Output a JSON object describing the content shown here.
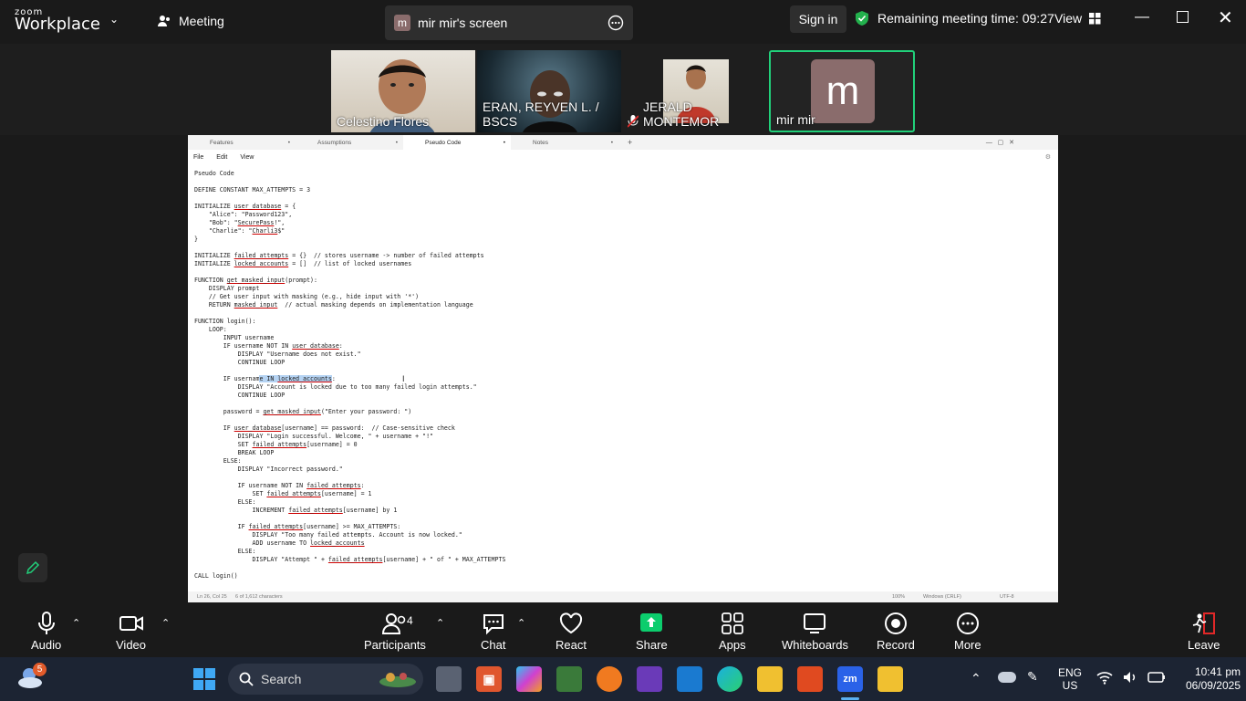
{
  "topbar": {
    "logo_line1": "zoom",
    "logo_line2": "Workplace",
    "meeting_label": "Meeting",
    "share_avatar": "m",
    "share_title": "mir mir's screen",
    "sign_in": "Sign in",
    "remaining_time": "Remaining meeting time: 09:27",
    "view_label": "View"
  },
  "participants": [
    {
      "name": "Celestino Flores"
    },
    {
      "name": "ERAN, REYVEN L. / BSCS"
    },
    {
      "name": "JERALD MONTEMOR"
    },
    {
      "name": "mir mir",
      "avatar": "m"
    }
  ],
  "editor": {
    "tabs": [
      "Features",
      "Assumptions",
      "Pseudo Code",
      "Notes"
    ],
    "active_tab": "Pseudo Code",
    "menu": [
      "File",
      "Edit",
      "View"
    ],
    "status_position": "Ln 26, Col 25",
    "status_chars": "6 of 1,612 characters",
    "status_zoom": "100%",
    "status_eol": "Windows (CRLF)",
    "status_encoding": "UTF-8",
    "lines": [
      "Pseudo Code",
      "",
      "DEFINE CONSTANT MAX_ATTEMPTS = 3",
      "",
      "INITIALIZE user_database = {",
      "    \"Alice\": \"Password123\",",
      "    \"Bob\": \"SecurePass!\",",
      "    \"Charlie\": \"Charli3$\"",
      "}",
      "",
      "INITIALIZE failed_attempts = {}  // stores username -> number of failed attempts",
      "INITIALIZE locked_accounts = []  // list of locked usernames",
      "",
      "FUNCTION get_masked_input(prompt):",
      "    DISPLAY prompt",
      "    // Get user input with masking (e.g., hide input with '*')",
      "    RETURN masked_input  // actual masking depends on implementation language",
      "",
      "FUNCTION login():",
      "    LOOP:",
      "        INPUT username",
      "        IF username NOT IN user_database:",
      "            DISPLAY \"Username does not exist.\"",
      "            CONTINUE LOOP",
      "",
      "        IF username IN locked_accounts:",
      "            DISPLAY \"Account is locked due to too many failed login attempts.\"",
      "            CONTINUE LOOP",
      "",
      "        password = get_masked_input(\"Enter your password: \")",
      "",
      "        IF user_database[username] == password:  // Case-sensitive check",
      "            DISPLAY \"Login successful. Welcome, \" + username + \"!\"",
      "            SET failed_attempts[username] = 0",
      "            BREAK LOOP",
      "        ELSE:",
      "            DISPLAY \"Incorrect password.\"",
      "",
      "            IF username NOT IN failed_attempts:",
      "                SET failed_attempts[username] = 1",
      "            ELSE:",
      "                INCREMENT failed_attempts[username] by 1",
      "",
      "            IF failed_attempts[username] >= MAX_ATTEMPTS:",
      "                DISPLAY \"Too many failed attempts. Account is now locked.\"",
      "                ADD username TO locked_accounts",
      "            ELSE:",
      "                DISPLAY \"Attempt \" + failed_attempts[username] + \" of \" + MAX_ATTEMPTS",
      "",
      "CALL login()"
    ],
    "spellcheck_words": [
      "user_database",
      "failed_attempts",
      "locked_accounts",
      "get_masked_input",
      "masked_input",
      "SecurePass",
      "Charli3"
    ],
    "selected_text": "e IN locked_accounts"
  },
  "controls": {
    "audio": "Audio",
    "video": "Video",
    "participants": "Participants",
    "participants_count": "4",
    "chat": "Chat",
    "react": "React",
    "share": "Share",
    "apps": "Apps",
    "whiteboards": "Whiteboards",
    "record": "Record",
    "more": "More",
    "leave": "Leave"
  },
  "taskbar": {
    "search_placeholder": "Search",
    "weather_badge": "5",
    "lang_line1": "ENG",
    "lang_line2": "US",
    "time": "10:41 pm",
    "date": "06/09/2025"
  },
  "colors": {
    "share_green": "#0ccd6d",
    "active_speaker": "#21d07a",
    "security_green": "#23b14d",
    "leave_red": "#e02828",
    "avatar_bg": "#8a6c6c"
  }
}
